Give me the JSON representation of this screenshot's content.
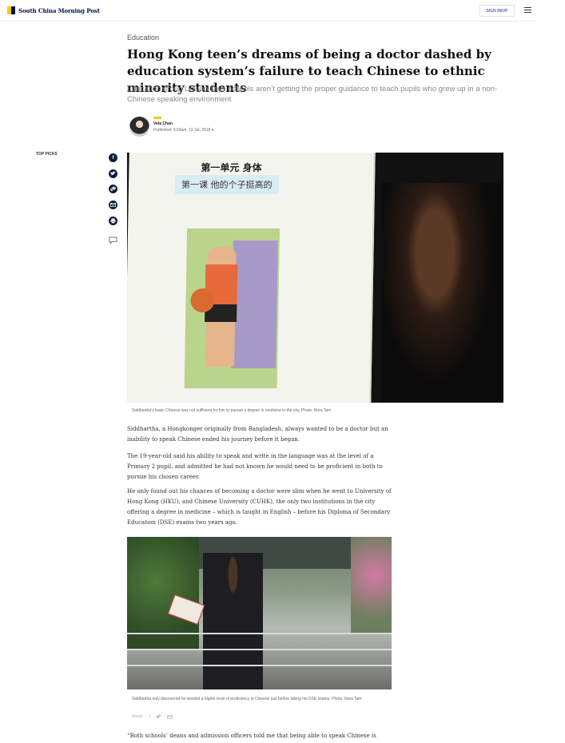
{
  "header": {
    "logo_text": "South China Morning Post",
    "signin_label": "SIGN IN/UP",
    "brand_colors": {
      "yellow": "#ffca05",
      "navy": "#001246"
    }
  },
  "article": {
    "section": "Education",
    "headline": "Hong Kong teen’s dreams of being a doctor dashed by education system’s failure to teach Chinese to ethnic minority students",
    "subhead": "Education group Unison says schools aren’t getting the proper guidance to teach pupils who grew up in a non-Chinese speaking environment",
    "author": "Vela Chan",
    "published": "Published: 9:03am, 10 Jul, 2018",
    "top_picks_label": "TOP PICKS",
    "share_icons": [
      "facebook-icon",
      "twitter-icon",
      "link-icon",
      "email-icon",
      "print-icon",
      "comment-icon"
    ],
    "hero_caption": "Siddhartha’s basic Chinese was not sufficient for him to pursue a degree in medicine in the city. Photo: Nora Tam",
    "hero_book": {
      "title": "第一单元  身体",
      "lesson": "第一课  他的个子挺高的"
    },
    "paragraphs": [
      "Siddhartha, a Hongkonger originally from Bangladesh, always wanted to be a doctor but an inability to speak Chinese ended his journey before it began.",
      "The 19-year-old said his ability to speak and write in the language was at the level of a Primary 2 pupil, and admitted he had not known he would need to be proficient in both to pursue his chosen career.",
      "He only found out his chances of becoming a doctor were slim when he went to University of Hong Kong (HKU), and Chinese University (CUHK), the only two institutions in the city offering a degree in medicine – which is taught in English – before his Diploma of Secondary Education (DSE) exams two years ago."
    ],
    "photo2_caption": "Siddhartha only discovered he needed a higher level of proficiency in Chinese just before taking his DSE exams. Photo: Nora Tam",
    "share_label": "Share:",
    "last_paragraph": "“Both schools’ deans and admission officers told me that being able to speak Chinese is"
  }
}
